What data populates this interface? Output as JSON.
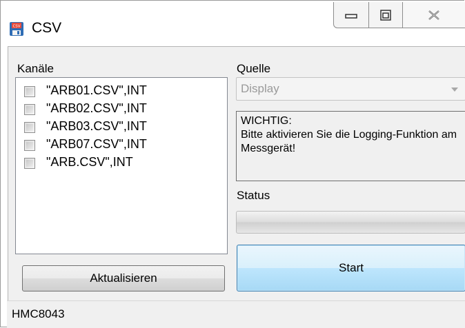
{
  "window": {
    "title": "CSV",
    "app_icon": "csv-floppy-icon",
    "caption_buttons": [
      "minimize-icon",
      "maximize-icon",
      "close-icon"
    ]
  },
  "channels": {
    "label": "Kanäle",
    "items": [
      {
        "label": "\"ARB01.CSV\",INT",
        "checked": false
      },
      {
        "label": "\"ARB02.CSV\",INT",
        "checked": false
      },
      {
        "label": "\"ARB03.CSV\",INT",
        "checked": false
      },
      {
        "label": "\"ARB07.CSV\",INT",
        "checked": false
      },
      {
        "label": "\"ARB.CSV\",INT",
        "checked": false
      }
    ],
    "refresh_label": "Aktualisieren"
  },
  "source": {
    "label": "Quelle",
    "selected": "Display",
    "enabled": false
  },
  "notice": {
    "text": "WICHTIG:\nBitte aktivieren Sie die Logging-Funktion am Messgerät!"
  },
  "status": {
    "label": "Status",
    "progress": 0
  },
  "actions": {
    "start_label": "Start"
  },
  "statusbar": {
    "device": "HMC8043"
  },
  "colors": {
    "accent_border": "#3c7fb1",
    "client_bg": "#f0f0f0"
  }
}
